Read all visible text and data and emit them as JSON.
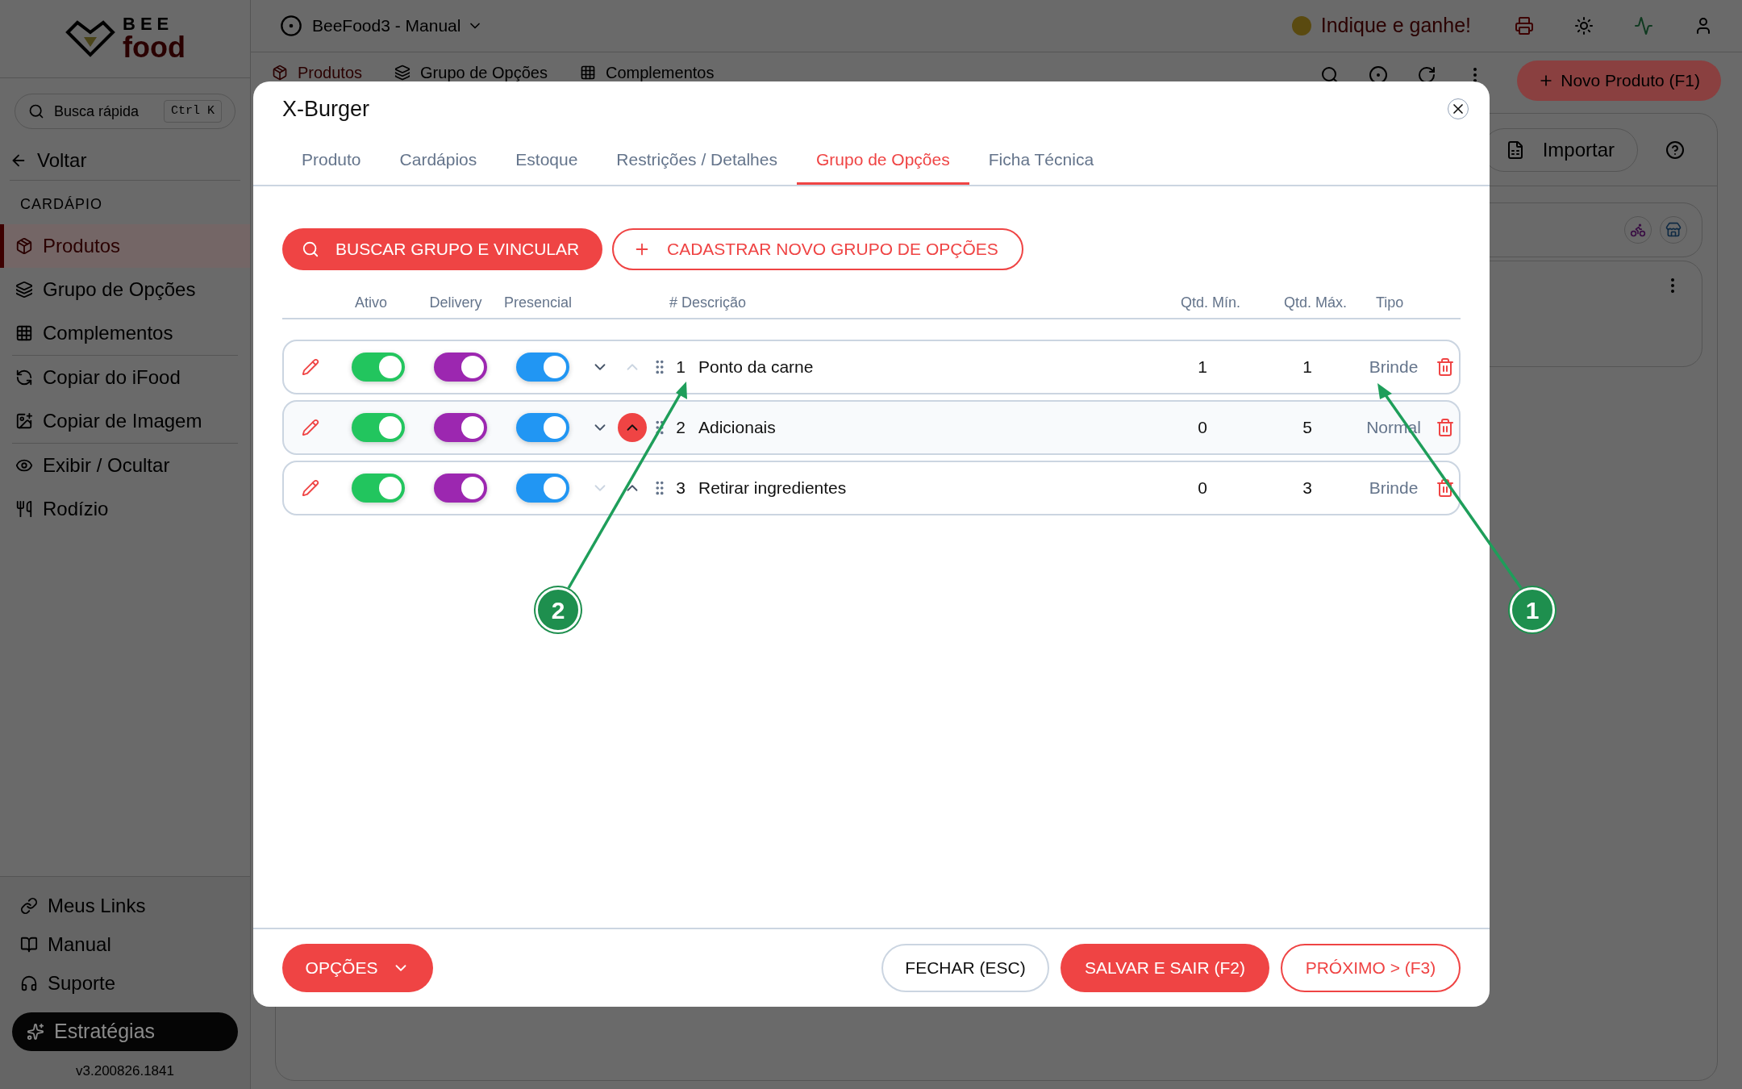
{
  "app": {
    "logo_top": "BEE",
    "logo_bottom": "food",
    "workspace": "BeeFood3 - Manual",
    "referral": "Indique e ganhe!"
  },
  "sidebar": {
    "search_placeholder": "Busca rápida",
    "shortcut": "Ctrl K",
    "back": "Voltar",
    "section": "CARDÁPIO",
    "items": [
      {
        "label": "Produtos",
        "selected": true
      },
      {
        "label": "Grupo de Opções",
        "selected": false
      },
      {
        "label": "Complementos",
        "selected": false
      },
      {
        "label": "Copiar do iFood",
        "selected": false
      },
      {
        "label": "Copiar de Imagem",
        "selected": false
      },
      {
        "label": "Exibir / Ocultar",
        "selected": false
      },
      {
        "label": "Rodízio",
        "selected": false
      }
    ],
    "footer_links": [
      "Meus Links",
      "Manual",
      "Suporte"
    ],
    "strategy": "Estratégias",
    "version": "v3.200826.1841"
  },
  "page": {
    "tabs": [
      {
        "label": "Produtos",
        "selected": true
      },
      {
        "label": "Grupo de Opções",
        "selected": false
      },
      {
        "label": "Complementos",
        "selected": false
      }
    ],
    "new_product": "Novo Produto (F1)",
    "import": "Importar"
  },
  "modal": {
    "title": "X-Burger",
    "tabs": [
      {
        "label": "Produto",
        "selected": false
      },
      {
        "label": "Cardápios",
        "selected": false
      },
      {
        "label": "Estoque",
        "selected": false
      },
      {
        "label": "Restrições / Detalhes",
        "selected": false
      },
      {
        "label": "Grupo de Opções",
        "selected": true
      },
      {
        "label": "Ficha Técnica",
        "selected": false
      }
    ],
    "search_link": "BUSCAR GRUPO E VINCULAR",
    "create_group": "CADASTRAR NOVO GRUPO DE OPÇÕES",
    "columns": [
      "Ativo",
      "Delivery",
      "Presencial",
      "# Descrição",
      "Qtd. Mín.",
      "Qtd. Máx.",
      "Tipo"
    ],
    "rows": [
      {
        "number": "1",
        "description": "Ponto da carne",
        "min": "1",
        "max": "1",
        "type": "Brinde",
        "active": true,
        "delivery": true,
        "presencial": true,
        "can_move_down": true,
        "can_move_up": false,
        "highlighted": false
      },
      {
        "number": "2",
        "description": "Adicionais",
        "min": "0",
        "max": "5",
        "type": "Normal",
        "active": true,
        "delivery": true,
        "presencial": true,
        "can_move_down": true,
        "can_move_up": true,
        "highlighted": true
      },
      {
        "number": "3",
        "description": "Retirar ingredientes",
        "min": "0",
        "max": "3",
        "type": "Brinde",
        "active": true,
        "delivery": true,
        "presencial": true,
        "can_move_down": false,
        "can_move_up": true,
        "highlighted": false
      }
    ],
    "options": "OPÇÕES",
    "close": "FECHAR (ESC)",
    "save": "SALVAR E SAIR (F2)",
    "next": "PRÓXIMO > (F3)"
  },
  "annotations": [
    {
      "label": "2"
    },
    {
      "label": "1"
    }
  ]
}
